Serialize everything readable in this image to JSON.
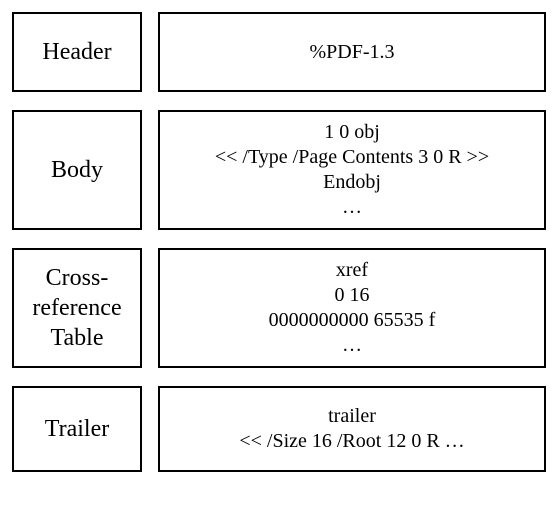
{
  "rows": [
    {
      "label": "Header",
      "lines": [
        "%PDF-1.3"
      ]
    },
    {
      "label": "Body",
      "lines": [
        "1 0 obj",
        "<< /Type /Page Contents 3 0 R >>",
        "Endobj",
        "…"
      ]
    },
    {
      "label": "Cross-reference Table",
      "lines": [
        "xref",
        "0 16",
        "0000000000 65535 f",
        "…"
      ]
    },
    {
      "label": "Trailer",
      "lines": [
        "trailer",
        "<< /Size 16 /Root 12 0 R …"
      ]
    }
  ]
}
